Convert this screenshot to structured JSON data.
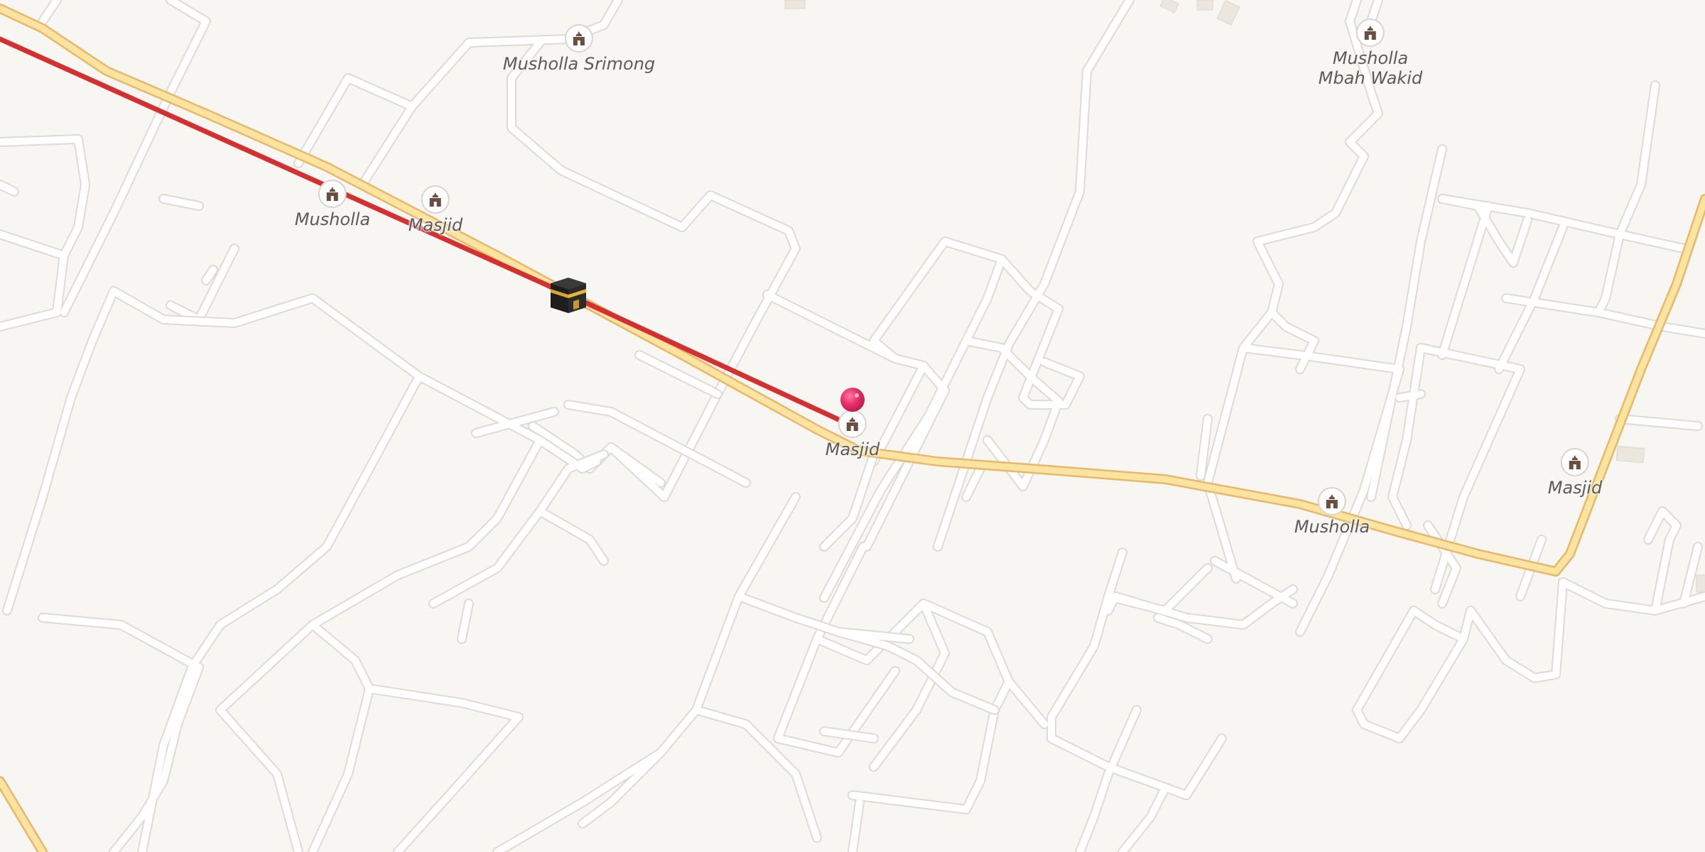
{
  "map": {
    "colors": {
      "background": "#f8f6f2",
      "minor_road": "#ffffff",
      "minor_road_casing": "#dedad5",
      "main_road": "#fde3a0",
      "main_road_casing": "#e7b86a",
      "route_line": "#d43030",
      "pin": "#e8306a"
    },
    "pois": [
      {
        "label": "Musholla Srimong",
        "icon": "mosque-icon"
      },
      {
        "label": "Musholla",
        "icon": "mosque-icon"
      },
      {
        "label": "Masjid",
        "icon": "mosque-icon"
      },
      {
        "label": "Masjid",
        "icon": "mosque-icon"
      },
      {
        "label": "Musholla",
        "icon": "mosque-icon"
      },
      {
        "label": "Masjid",
        "icon": "mosque-icon"
      }
    ],
    "poi_multiline": {
      "line1": "Musholla",
      "line2": "Mbah Wakid",
      "icon": "mosque-icon"
    },
    "markers": {
      "destination": "kaaba-icon",
      "current_location": "pin-marker"
    }
  }
}
